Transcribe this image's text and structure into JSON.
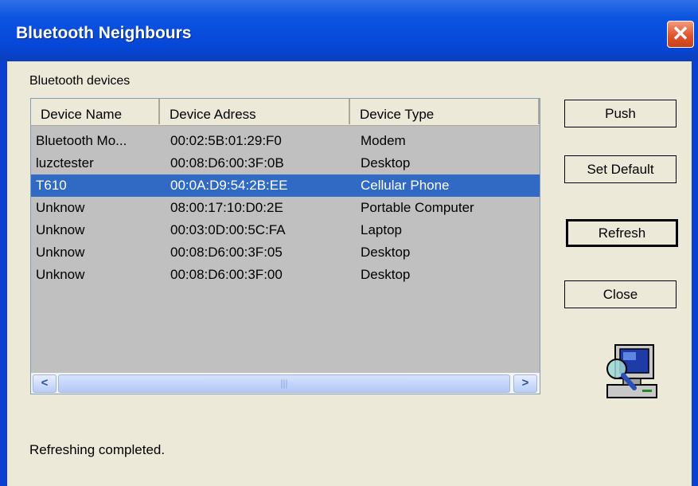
{
  "window": {
    "title": "Bluetooth Neighbours",
    "close_glyph": "✕"
  },
  "group_label": "Bluetooth devices",
  "columns": [
    "Device Name",
    "Device Adress",
    "Device Type"
  ],
  "devices": [
    {
      "name": "Bluetooth Mo...",
      "address": "00:02:5B:01:29:F0",
      "type": "Modem"
    },
    {
      "name": "luzctester",
      "address": "00:08:D6:00:3F:0B",
      "type": "Desktop"
    },
    {
      "name": "T610",
      "address": "00:0A:D9:54:2B:EE",
      "type": "Cellular Phone"
    },
    {
      "name": "Unknow",
      "address": "08:00:17:10:D0:2E",
      "type": "Portable Computer"
    },
    {
      "name": "Unknow",
      "address": "00:03:0D:00:5C:FA",
      "type": "Laptop"
    },
    {
      "name": "Unknow",
      "address": "00:08:D6:00:3F:05",
      "type": "Desktop"
    },
    {
      "name": "Unknow",
      "address": "00:08:D6:00:3F:00",
      "type": "Desktop"
    }
  ],
  "selected_row": 2,
  "scrollbar": {
    "left_glyph": "<",
    "right_glyph": ">",
    "thumb_grip": "|||"
  },
  "buttons": {
    "push": "Push",
    "set_default": "Set Default",
    "refresh": "Refresh",
    "close": "Close"
  },
  "status": "Refreshing completed.",
  "icons": {
    "computer": "computer-search-icon"
  },
  "colors": {
    "title_bar": "#0b54e0",
    "selection": "#316ac5",
    "list_bg": "#c0c0c0",
    "dialog_bg": "#ece9d8"
  }
}
